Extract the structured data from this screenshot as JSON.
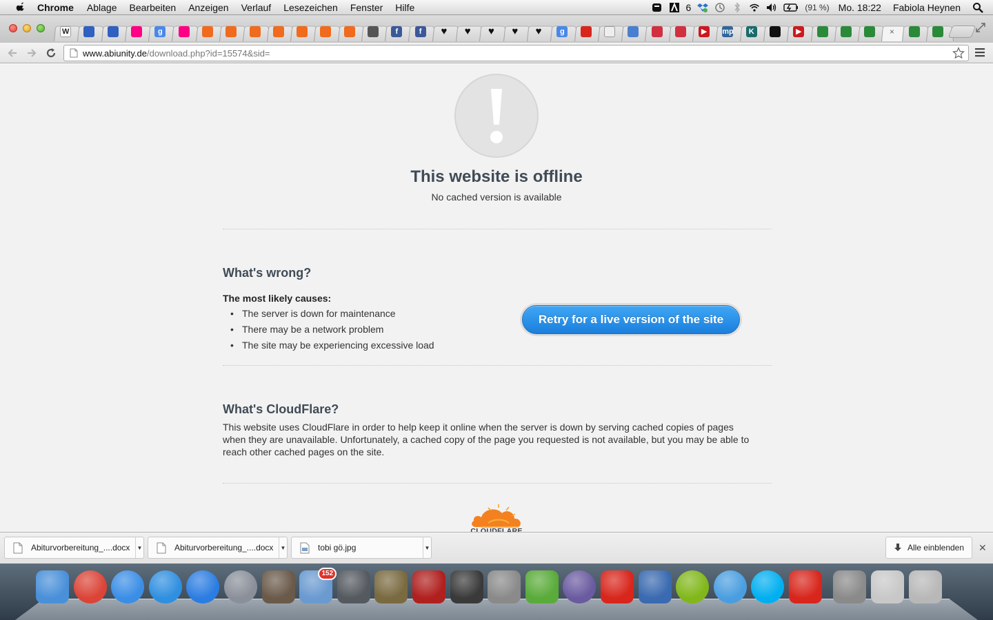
{
  "menubar": {
    "app_name": "Chrome",
    "menus": [
      "Ablage",
      "Bearbeiten",
      "Anzeigen",
      "Verlauf",
      "Lesezeichen",
      "Fenster",
      "Hilfe"
    ],
    "tray_badge": "6",
    "battery": "(91 %)",
    "clock": "Mo. 18:22",
    "user": "Fabiola Heynen"
  },
  "tabs": [
    {
      "favicon": "wikipedia-icon",
      "glyph": "W",
      "color": "#ffffff"
    },
    {
      "favicon": "firefox-icon",
      "glyph": "",
      "color": "#3060c0"
    },
    {
      "favicon": "firefox-icon",
      "glyph": "",
      "color": "#3060c0"
    },
    {
      "favicon": "flickr-icon",
      "glyph": "",
      "color": "#ff0084"
    },
    {
      "favicon": "google-icon",
      "glyph": "g",
      "color": "#4a88e8"
    },
    {
      "favicon": "flickr-icon",
      "glyph": "",
      "color": "#ff0084"
    },
    {
      "favicon": "orange-bookmark-icon",
      "glyph": "",
      "color": "#f06b1d"
    },
    {
      "favicon": "orange-bookmark-icon",
      "glyph": "",
      "color": "#f06b1d"
    },
    {
      "favicon": "orange-bookmark-icon",
      "glyph": "",
      "color": "#f06b1d"
    },
    {
      "favicon": "orange-bookmark-icon",
      "glyph": "",
      "color": "#f06b1d"
    },
    {
      "favicon": "orange-bookmark-icon",
      "glyph": "",
      "color": "#f06b1d"
    },
    {
      "favicon": "orange-bookmark-icon",
      "glyph": "",
      "color": "#f06b1d"
    },
    {
      "favicon": "orange-bookmark-icon",
      "glyph": "",
      "color": "#f06b1d"
    },
    {
      "favicon": "mgi-icon",
      "glyph": "",
      "color": "#555555"
    },
    {
      "favicon": "facebook-icon",
      "glyph": "f",
      "color": "#3b5998"
    },
    {
      "favicon": "facebook-icon",
      "glyph": "f",
      "color": "#3b5998"
    },
    {
      "favicon": "heart-icon",
      "glyph": "♥",
      "color": "#111111"
    },
    {
      "favicon": "heart-icon",
      "glyph": "♥",
      "color": "#111111"
    },
    {
      "favicon": "heart-icon",
      "glyph": "♥",
      "color": "#111111"
    },
    {
      "favicon": "heart-icon",
      "glyph": "♥",
      "color": "#111111"
    },
    {
      "favicon": "heart-icon",
      "glyph": "♥",
      "color": "#111111"
    },
    {
      "favicon": "google-icon",
      "glyph": "g",
      "color": "#4a88e8"
    },
    {
      "favicon": "adobe-icon",
      "glyph": "",
      "color": "#d8261c"
    },
    {
      "favicon": "blank-page-icon",
      "glyph": "",
      "color": "#eeeeee"
    },
    {
      "favicon": "blue-diamond-icon",
      "glyph": "",
      "color": "#4a7fd0"
    },
    {
      "favicon": "sat1-icon",
      "glyph": "",
      "color": "#d03040"
    },
    {
      "favicon": "sat1-icon",
      "glyph": "",
      "color": "#d03040"
    },
    {
      "favicon": "youtube-icon",
      "glyph": "▶",
      "color": "#cc181e"
    },
    {
      "favicon": "mp-icon",
      "glyph": "mp",
      "color": "#336699"
    },
    {
      "favicon": "k-icon",
      "glyph": "K",
      "color": "#1a6b6b"
    },
    {
      "favicon": "sixx-icon",
      "glyph": "",
      "color": "#111111"
    },
    {
      "favicon": "youtube-icon",
      "glyph": "▶",
      "color": "#cc181e"
    },
    {
      "favicon": "bird-icon",
      "glyph": "",
      "color": "#2a8a3a"
    },
    {
      "favicon": "bird-icon",
      "glyph": "",
      "color": "#2a8a3a"
    },
    {
      "favicon": "bird-icon",
      "glyph": "",
      "color": "#2a8a3a"
    },
    {
      "favicon": "close-tab-icon",
      "glyph": "×",
      "color": "#666666",
      "active": true
    },
    {
      "favicon": "bird-icon",
      "glyph": "",
      "color": "#2a8a3a"
    },
    {
      "favicon": "bird-icon",
      "glyph": "",
      "color": "#2a8a3a"
    }
  ],
  "omnibox": {
    "host": "www.abiunity.de",
    "path": "/download.php?id=15574&sid="
  },
  "page": {
    "title": "This website is offline",
    "subtitle": "No cached version is available",
    "wrong_heading": "What's wrong?",
    "causes_label": "The most likely causes:",
    "causes": [
      "The server is down for maintenance",
      "There may be a network problem",
      "The site may be experiencing excessive load"
    ],
    "retry_label": "Retry for a live version of the site",
    "cf_heading": "What's CloudFlare?",
    "cf_text_lines": [
      "This website uses CloudFlare in order to help keep it online when the server is down by serving cached copies of pages",
      "when they are unavailable. Unfortunately, a cached copy of the page you requested is not available, but you may be able to",
      "reach other cached pages on the site."
    ],
    "logo_text": "CLOUDFLARE",
    "accent_color": "#1b7fdc",
    "logo_color": "#f48120"
  },
  "downloads": {
    "items": [
      {
        "name": "Abiturvorbereitung_....docx"
      },
      {
        "name": "Abiturvorbereitung_....docx"
      },
      {
        "name": "tobi gö.jpg"
      }
    ],
    "show_all_label": "Alle einblenden"
  },
  "dock": {
    "apps": [
      {
        "icon": "finder-icon",
        "color": "#4a90d9"
      },
      {
        "icon": "chrome-icon",
        "color": "#db4437"
      },
      {
        "icon": "safari-icon",
        "color": "#3a8ee6"
      },
      {
        "icon": "itunes-icon",
        "color": "#2f8fe0"
      },
      {
        "icon": "app-store-icon",
        "color": "#2b7de1"
      },
      {
        "icon": "launchpad-icon",
        "color": "#8a8f99"
      },
      {
        "icon": "photo-booth-icon",
        "color": "#6a5a4a"
      },
      {
        "icon": "mail-icon",
        "color": "#6a9ad0",
        "badge": "152"
      },
      {
        "icon": "facetime-icon",
        "color": "#555a60"
      },
      {
        "icon": "iphoto-icon",
        "color": "#7a6a40"
      },
      {
        "icon": "photo-booth-red-icon",
        "color": "#b0201e"
      },
      {
        "icon": "imovie-icon",
        "color": "#3a3a3a"
      },
      {
        "icon": "system-preferences-icon",
        "color": "#8a8a8a"
      },
      {
        "icon": "evernote-icon",
        "color": "#5aab3a"
      },
      {
        "icon": "quill-icon",
        "color": "#6a5aa0"
      },
      {
        "icon": "acrobat-icon",
        "color": "#d8261c"
      },
      {
        "icon": "keynote-icon",
        "color": "#3a6ab0"
      },
      {
        "icon": "spotify-icon",
        "color": "#81b71a"
      },
      {
        "icon": "cloud-icon",
        "color": "#4a9ee0"
      },
      {
        "icon": "skype-icon",
        "color": "#00aff0"
      },
      {
        "icon": "acrobat-sync-icon",
        "color": "#d8261c"
      }
    ],
    "docs": [
      {
        "icon": "documents-stack-icon",
        "color": "#8a8a8a"
      },
      {
        "icon": "window-thumbnail-icon",
        "color": "#c8c8c8"
      },
      {
        "icon": "trash-icon",
        "color": "#b8b8b8"
      }
    ]
  }
}
